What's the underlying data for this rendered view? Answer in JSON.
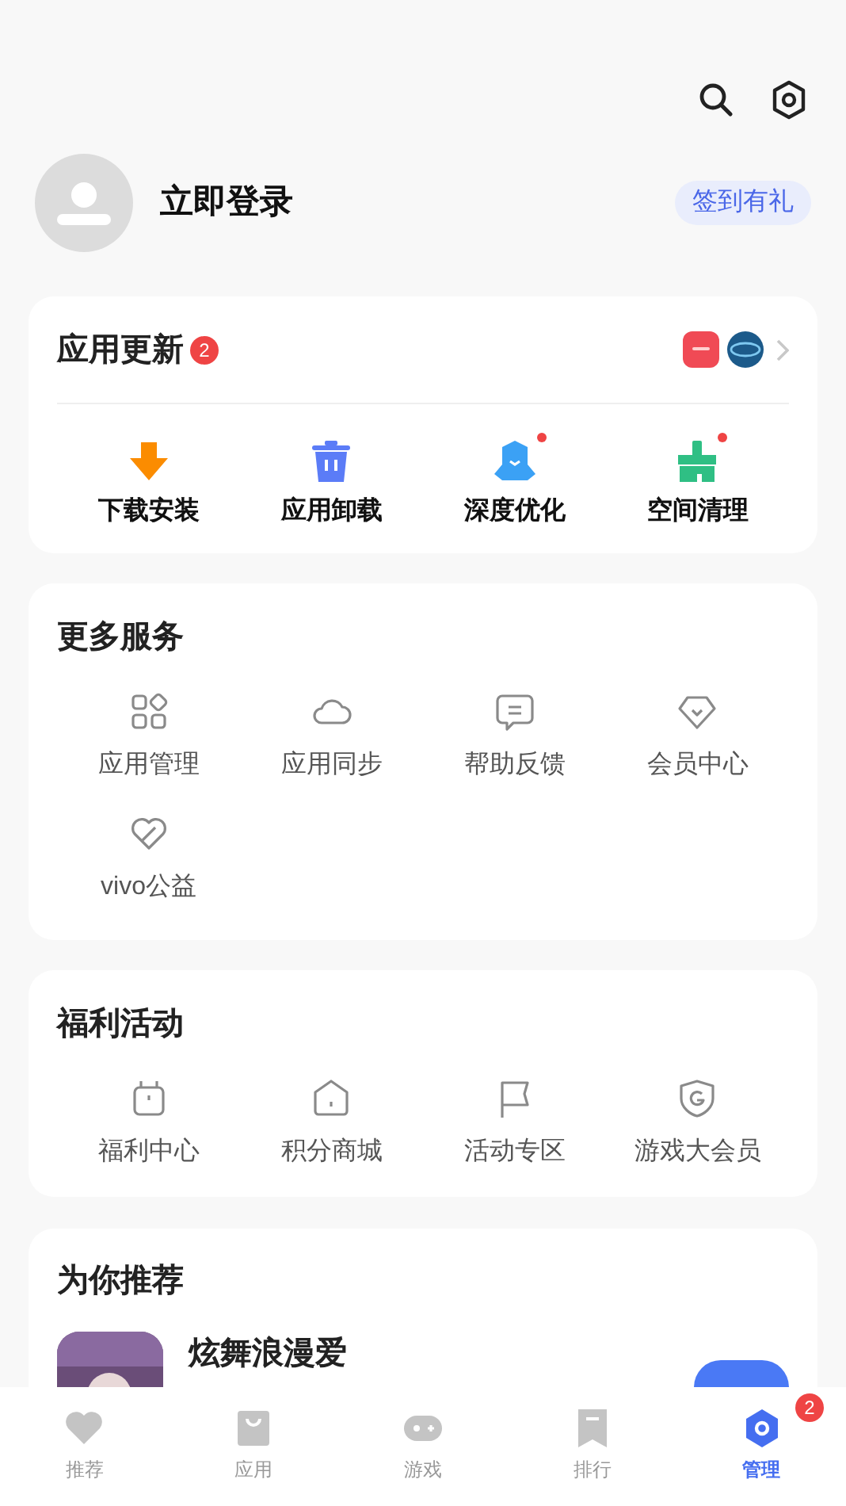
{
  "profile": {
    "name": "立即登录",
    "checkin_button": "签到有礼"
  },
  "updates": {
    "title": "应用更新",
    "badge": "2",
    "tools": [
      {
        "label": "下载安装",
        "dot": false
      },
      {
        "label": "应用卸载",
        "dot": false
      },
      {
        "label": "深度优化",
        "dot": true
      },
      {
        "label": "空间清理",
        "dot": true
      }
    ]
  },
  "more_services": {
    "title": "更多服务",
    "items": [
      "应用管理",
      "应用同步",
      "帮助反馈",
      "会员中心",
      "vivo公益"
    ]
  },
  "welfare": {
    "title": "福利活动",
    "items": [
      "福利中心",
      "积分商城",
      "活动专区",
      "游戏大会员"
    ]
  },
  "recommend": {
    "title": "为你推荐",
    "app": {
      "name": "炫舞浪漫爱"
    }
  },
  "nav": [
    {
      "label": "推荐",
      "selected": false
    },
    {
      "label": "应用",
      "selected": false
    },
    {
      "label": "游戏",
      "selected": false
    },
    {
      "label": "排行",
      "selected": false
    },
    {
      "label": "管理",
      "selected": true,
      "badge": "2"
    }
  ]
}
